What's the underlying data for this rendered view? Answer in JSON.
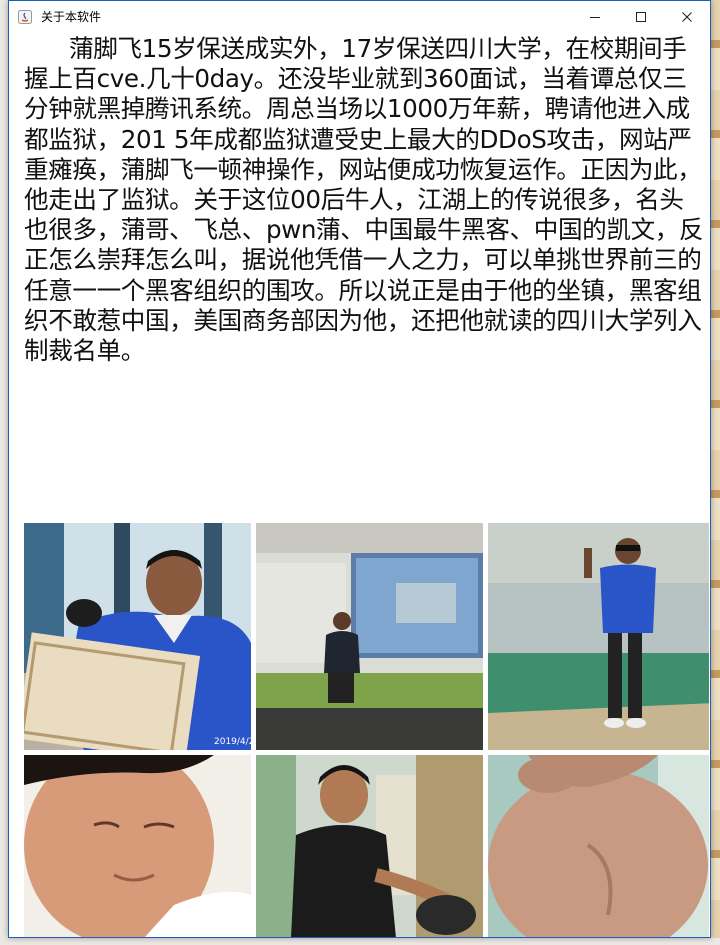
{
  "window": {
    "title": "关于本软件",
    "controls": {
      "minimize": "minimize-icon",
      "maximize": "maximize-icon",
      "close": "close-icon"
    }
  },
  "article": {
    "text": "蒲脚飞15岁保送成实外，17岁保送四川大学，在校期间手握上百cve.几十0day。还没毕业就到360面试，当着谭总仅三分钟就黑掉腾讯系统。周总当场以1000万年薪，聘请他进入成都监狱，201 5年成都监狱遭受史上最大的DDoS攻击，网站严重瘫痪，蒲脚飞一顿神操作，网站便成功恢复运作。正因为此，他走出了监狱。关于这位00后牛人，江湖上的传说很多，名头也很多，蒲哥、飞总、pwn蒲、中国最牛黑客、中国的凯文，反正怎么崇拜怎么叫，据说他凭借一人之力，可以单挑世界前三的任意一一个黑客组织的围攻。所以说正是由于他的坐镇，黑客组织不敢惹中国，美国商务部因为他，还把他就读的四川大学列入制裁名单。"
  },
  "photos": [
    {
      "timestamp": "2019/4/2"
    },
    {},
    {},
    {},
    {},
    {}
  ],
  "colors": {
    "title_bar_border": "#1d5fb8",
    "jacket_blue": "#2a55c9"
  }
}
